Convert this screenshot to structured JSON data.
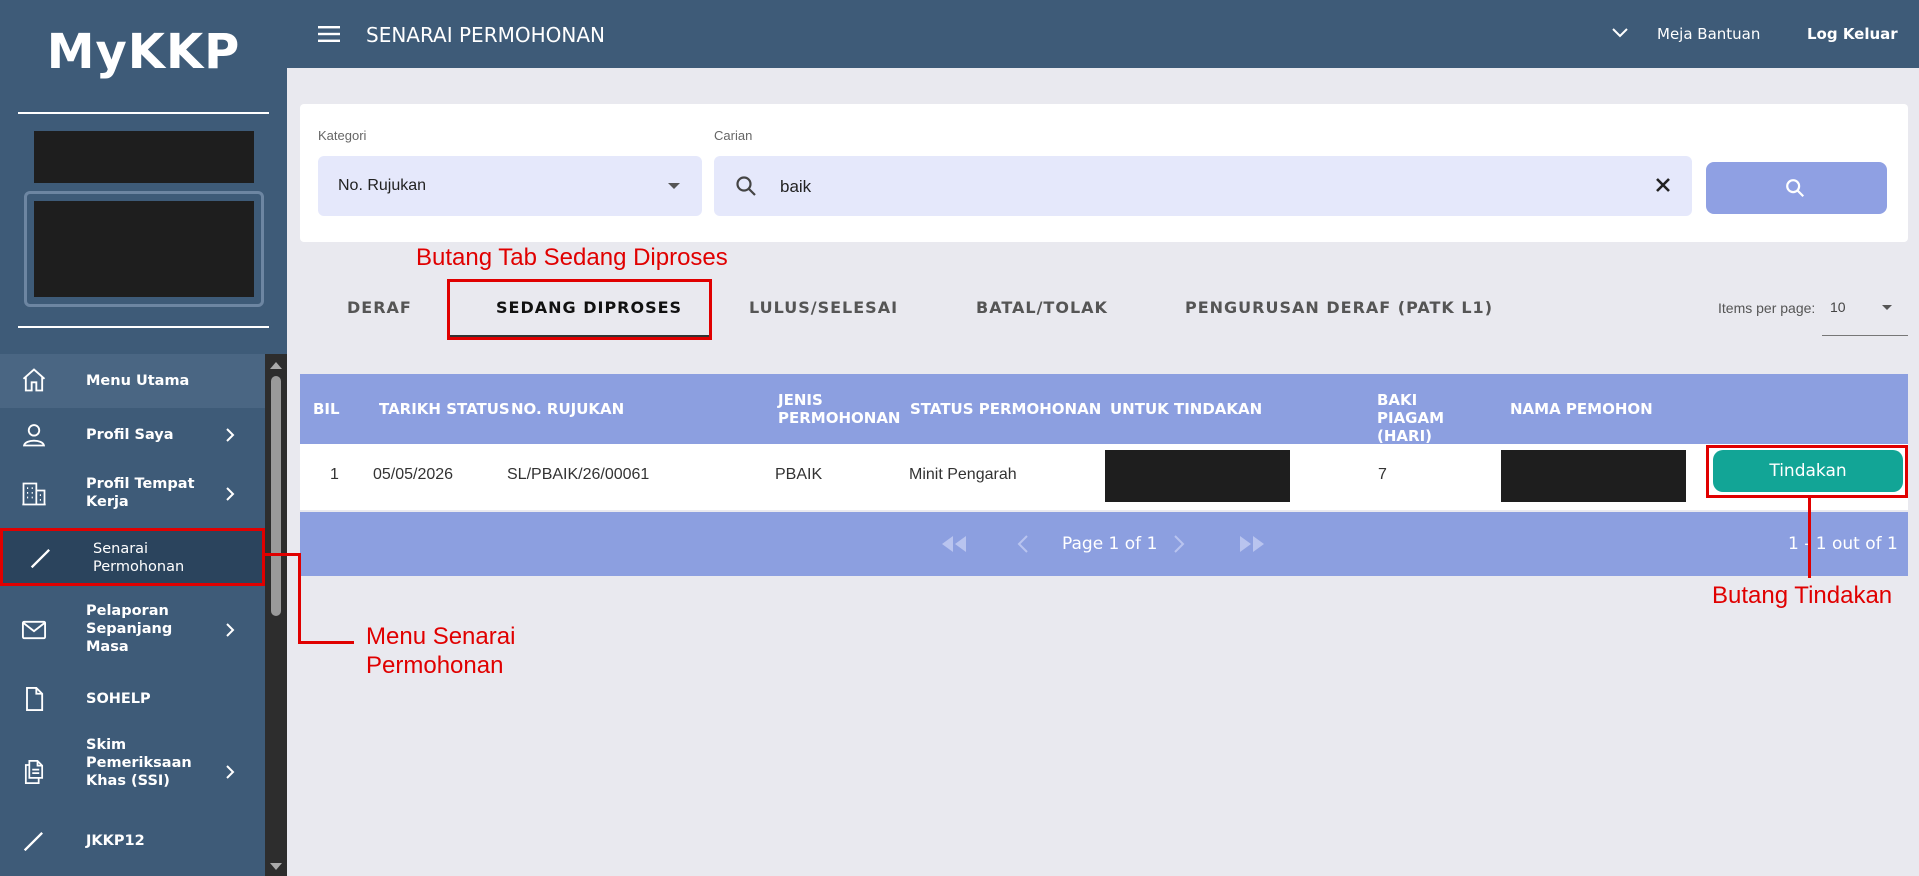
{
  "app": {
    "logo": "MyKKP"
  },
  "sidebar": {
    "items": [
      {
        "label": "Menu Utama",
        "icon": "home-icon"
      },
      {
        "label": "Profil Saya",
        "icon": "user-icon"
      },
      {
        "label": "Profil Tempat Kerja",
        "icon": "building-icon"
      },
      {
        "label": "Senarai Permohonan",
        "icon": "pencil-icon"
      },
      {
        "label": "Pelaporan Sepanjang Masa",
        "icon": "mail-icon"
      },
      {
        "label": "SOHELP",
        "icon": "document-icon"
      },
      {
        "label": "Skim Pemeriksaan Khas (SSI)",
        "icon": "documents-icon"
      },
      {
        "label": "JKKP12",
        "icon": "pencil-icon"
      }
    ]
  },
  "topbar": {
    "title": "SENARAI PERMOHONAN",
    "help": "Meja Bantuan",
    "logout": "Log Keluar"
  },
  "filter": {
    "kategori_label": "Kategori",
    "kategori_value": "No. Rujukan",
    "carian_label": "Carian",
    "carian_value": "baik"
  },
  "tabs": [
    {
      "label": "DERAF"
    },
    {
      "label": "SEDANG DIPROSES",
      "active": true
    },
    {
      "label": "LULUS/SELESAI"
    },
    {
      "label": "BATAL/TOLAK"
    },
    {
      "label": "PENGURUSAN DERAF (PATK L1)"
    }
  ],
  "paging": {
    "items_per_page_label": "Items per page:",
    "items_per_page": "10",
    "page_text": "Page 1 of 1",
    "range_text": "1 - 1 out of 1"
  },
  "table": {
    "headers": [
      "BIL",
      "TARIKH STATUS",
      "NO. RUJUKAN",
      "JENIS PERMOHONAN",
      "STATUS PERMOHONAN",
      "UNTUK TINDAKAN",
      "BAKI PIAGAM (HARI)",
      "NAMA PEMOHON"
    ],
    "rows": [
      {
        "bil": "1",
        "tarikh": "05/05/2026",
        "rujukan": "SL/PBAIK/26/00061",
        "jenis": "PBAIK",
        "status": "Minit Pengarah",
        "baki": "7",
        "action": "Tindakan"
      }
    ]
  },
  "annotations": {
    "tab": "Butang Tab Sedang Diproses",
    "menu_line1": "Menu Senarai",
    "menu_line2": "Permohonan",
    "action": "Butang Tindakan"
  },
  "colors": {
    "sidebar": "#3e5b78",
    "accent": "#8c9fe0",
    "action": "#12a596",
    "annotation": "#e00000"
  }
}
